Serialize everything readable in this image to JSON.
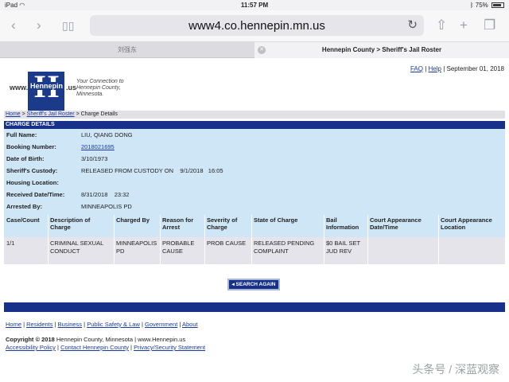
{
  "status_bar": {
    "device": "iPad",
    "time": "11:57 PM",
    "battery": "75%"
  },
  "browser": {
    "url": "www4.co.hennepin.mn.us",
    "tabs": [
      {
        "label": "刘强东"
      },
      {
        "label": "Hennepin County > Sheriff's Jail Roster"
      }
    ]
  },
  "header": {
    "logo_www": "www.",
    "logo_name": "Hennepin",
    "logo_us": ".us",
    "tagline_1": "Your Connection to",
    "tagline_2": "Hennepin County,",
    "tagline_3": "Minnesota.",
    "faq": "FAQ",
    "help": "Help",
    "date": "September 01, 2018"
  },
  "breadcrumb": {
    "home": "Home",
    "roster": "Sheriff's Jail Roster",
    "current": "Charge Details"
  },
  "section_title": "CHARGE DETAILS",
  "details": [
    {
      "label": "Full Name:",
      "value": "LIU, QIANG  DONG"
    },
    {
      "label": "Booking Number:",
      "value": "2018021695"
    },
    {
      "label": "Date of Birth:",
      "value": "3/10/1973"
    },
    {
      "label": "Sheriff's Custody:",
      "value": "RELEASED FROM CUSTODY ON    9/1/2018   16:05"
    },
    {
      "label": "Housing Location:",
      "value": ""
    },
    {
      "label": "Received Date/Time:",
      "value": "8/31/2018    23:32"
    },
    {
      "label": "Arrested By:",
      "value": "MINNEAPOLIS PD"
    }
  ],
  "charges_table": {
    "headers": [
      "Case/Count",
      "Description of Charge",
      "Charged By",
      "Reason for Arrest",
      "Severity of Charge",
      "State of Charge",
      "Bail Information",
      "Court Appearance Date/Time",
      "Court Appearance Location"
    ],
    "rows": [
      [
        "1/1",
        "CRIMINAL SEXUAL CONDUCT",
        "MINNEAPOLIS PD",
        "PROBABLE CAUSE",
        "PROB CAUSE",
        "RELEASED PENDING COMPLAINT",
        "$0 BAIL SET JUD REV",
        "",
        ""
      ]
    ]
  },
  "search_again_label": "SEARCH AGAIN",
  "footer": {
    "links": [
      "Home",
      "Residents",
      "Business",
      "Public Safety & Law",
      "Government",
      "About"
    ],
    "copyright": "Copyright © 2018",
    "copyright_rest": "Hennepin County, Minnesota | www.Hennepin.us",
    "links2": [
      "Accessibility Policy",
      "Contact Hennepin County",
      "Privacy/Security Statement"
    ]
  },
  "watermark": "头条号 / 深蓝观察"
}
